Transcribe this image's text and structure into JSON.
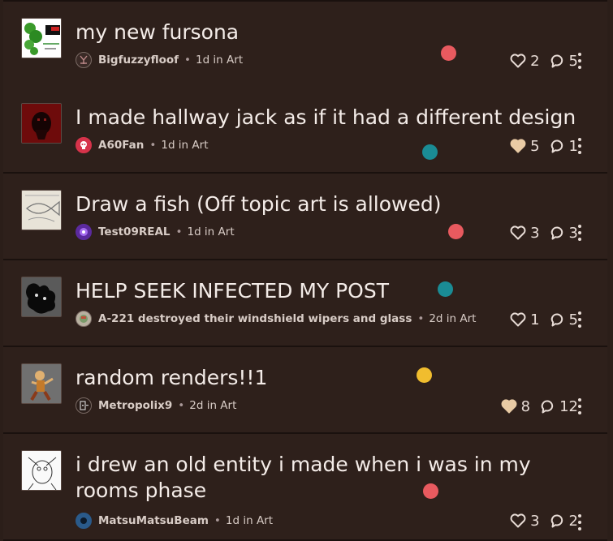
{
  "colors": {
    "red": "#e85a5f",
    "teal": "#1a8c95",
    "yellow": "#f1bd2e",
    "heart_filled": "#e9cba5"
  },
  "posts": [
    {
      "title": "my new fursona",
      "author": "Bigfuzzyfloof",
      "time": "1d in Art",
      "likes": "2",
      "comments": "5",
      "liked": false,
      "marker_color": "red"
    },
    {
      "title": "I made hallway jack as if it had a different design",
      "author": "A60Fan",
      "time": "1d in Art",
      "likes": "5",
      "comments": "1",
      "liked": true,
      "marker_color": "teal"
    },
    {
      "title": "Draw a fish (Off topic art is allowed)",
      "author": "Test09REAL",
      "time": "1d in Art",
      "likes": "3",
      "comments": "3",
      "liked": false,
      "marker_color": "red"
    },
    {
      "title": "HELP SEEK INFECTED MY POST",
      "author": "A-221 destroyed their windshield wipers and glass",
      "time": "2d in Art",
      "likes": "1",
      "comments": "5",
      "liked": false,
      "marker_color": "teal"
    },
    {
      "title": "random renders!!1",
      "author": "Metropolix9",
      "time": "2d in Art",
      "likes": "8",
      "comments": "12",
      "liked": true,
      "marker_color": "yellow"
    },
    {
      "title": "i drew an old entity i made when i was in my rooms phase",
      "author": "MatsuMatsuBeam",
      "time": "1d in Art",
      "likes": "3",
      "comments": "2",
      "liked": false,
      "marker_color": "red"
    }
  ]
}
